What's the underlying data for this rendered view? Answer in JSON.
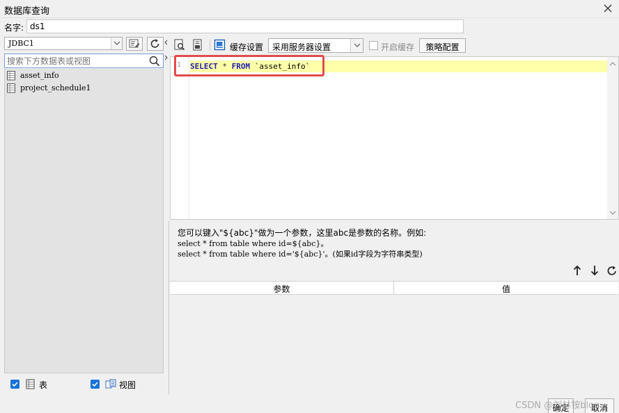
{
  "window": {
    "title": "数据库查询"
  },
  "name_field": {
    "label": "名字:",
    "value": "ds1"
  },
  "left": {
    "connection": "JDBC1",
    "search_placeholder": "搜索下方数据表或视图",
    "tables": [
      {
        "name": "asset_info"
      },
      {
        "name": "project_schedule1"
      }
    ],
    "show_tables_label": "表",
    "show_views_label": "视图"
  },
  "toolbar": {
    "cache_settings_label": "缓存设置",
    "cache_mode": "采用服务器设置",
    "enable_cache_label": "开启缓存",
    "strategy_label": "策略配置"
  },
  "editor": {
    "line_number": "1",
    "tokens": [
      {
        "text": "SELECT",
        "kind": "kw"
      },
      {
        "text": " * ",
        "kind": "op"
      },
      {
        "text": "FROM",
        "kind": "kw"
      },
      {
        "text": " `asset_info`",
        "kind": "str"
      }
    ]
  },
  "hint": {
    "line1": "您可以键入\"${abc}\"做为一个参数，这里abc是参数的名称。例如:",
    "line2": "select * from table where id=${abc}。",
    "line3": "select * from table where id='${abc}'。(如果id字段为字符串类型)"
  },
  "params": {
    "col_param": "参数",
    "col_value": "值"
  },
  "footer": {
    "ok_label": "确定",
    "cancel_label": "取消"
  },
  "watermark": "CSDN @刘林铵blog",
  "colors": {
    "highlight_box": "#e14b4b",
    "checkbox_accent": "#1a73d8",
    "keyword": "#1e1ea8",
    "current_line": "#ffffaa"
  }
}
